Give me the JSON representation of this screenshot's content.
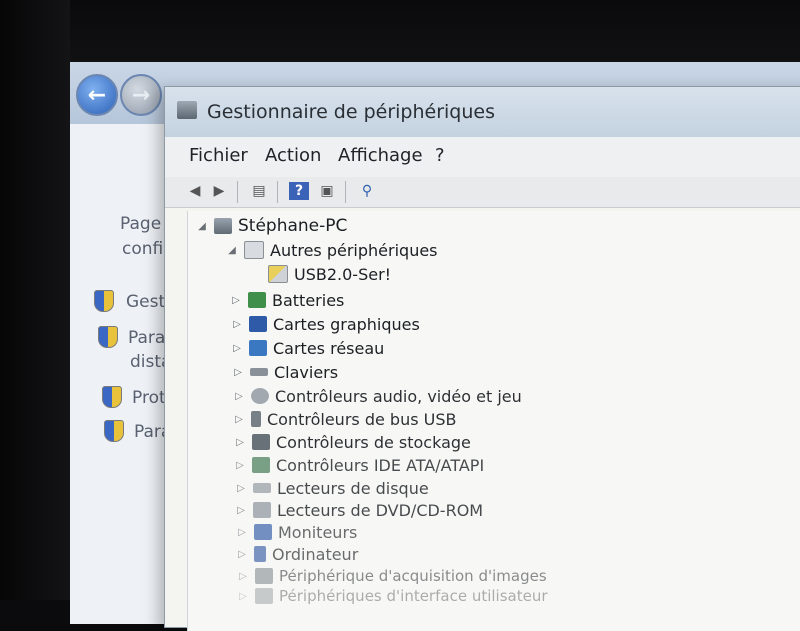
{
  "background_window": {
    "left_text": [
      "Page",
      "confi"
    ],
    "side_items": [
      "Gesti",
      "Param",
      "dista",
      "Prote",
      "Param"
    ]
  },
  "device_manager": {
    "title": "Gestionnaire de périphériques",
    "menu": [
      "Fichier",
      "Action",
      "Affichage",
      "?"
    ],
    "tree": {
      "computer": "Stéphane-PC",
      "other_devices": "Autres périphériques",
      "unknown_device": "USB2.0-Ser!",
      "categories": [
        "Batteries",
        "Cartes graphiques",
        "Cartes réseau",
        "Claviers",
        "Contrôleurs audio, vidéo et jeu",
        "Contrôleurs de bus USB",
        "Contrôleurs de stockage",
        "Contrôleurs IDE ATA/ATAPI",
        "Lecteurs de disque",
        "Lecteurs de DVD/CD-ROM",
        "Moniteurs",
        "Ordinateur",
        "Périphérique d'acquisition d'images",
        "Périphériques d'interface utilisateur"
      ]
    }
  },
  "colors": {
    "window_bg": "#f4f4f1",
    "title_bar": "#c4d2e0",
    "nav_back": "#2c62b8"
  }
}
